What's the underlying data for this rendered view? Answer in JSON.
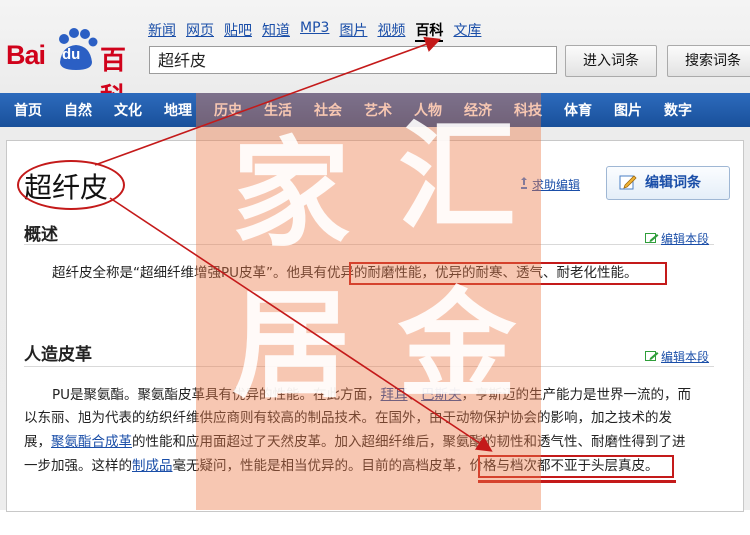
{
  "logo": {
    "left_text": "Bai",
    "paw_text": "du",
    "right_text": "百科"
  },
  "topnav": [
    "新闻",
    "网页",
    "贴吧",
    "知道",
    "MP3",
    "图片",
    "视频",
    "百科",
    "文库"
  ],
  "search": {
    "value": "超纤皮"
  },
  "buttons": {
    "enter": "进入词条",
    "search": "搜索词条"
  },
  "categories": [
    "首页",
    "自然",
    "文化",
    "地理",
    "历史",
    "生活",
    "社会",
    "艺术",
    "人物",
    "经济",
    "科技",
    "体育",
    "图片",
    "数字"
  ],
  "entry": {
    "title": "超纤皮",
    "help_link": "求助编辑",
    "edit_button": "编辑词条"
  },
  "sections": [
    {
      "heading": "概述",
      "edit_link": "编辑本段",
      "text_a": "超纤皮全称是“超细纤维增强PU皮革”。他具有",
      "text_highlight": "优异的耐磨性能，优异的耐寒、透气、耐老化性能。"
    },
    {
      "heading": "人造皮革",
      "edit_link": "编辑本段",
      "l1_a": "PU是聚氨酯。聚氨酯皮革具有优异的性能。在此方面，",
      "l1_link1": "拜耳",
      "l1_sep": "、",
      "l1_link2": "巴斯夫",
      "l1_b": "，亨斯迈的生产能力是世界一流的，而",
      "l2": "以东丽、旭为代表的纺织纤维供应商则有较高的制品技术。在国外，由于动物保护协会的影响，加之技术的发",
      "l3_a": "展，",
      "l3_link": "聚氨酯合成革",
      "l3_b": "的性能和应用面超过了天然皮革。加入超细纤维后，聚氨酯的韧性和透气性、耐磨性得到了进",
      "l4_a": "一步加强。这样的",
      "l4_link": "制成品",
      "l4_b": "毫无疑问，性能是相当优异的。目前的高档皮革，",
      "l4_highlight": "价格与档次都不亚于头层真皮。"
    }
  ],
  "watermark": {
    "c1": "家",
    "c2": "汇",
    "c3": "居",
    "c4": "金"
  },
  "colors": {
    "brand_red": "#d0021b",
    "nav_blue": "#1d5aa8",
    "link_blue": "#1a4ea8",
    "annotation_red": "#c41a1a",
    "watermark_orange": "#ec7a48"
  }
}
